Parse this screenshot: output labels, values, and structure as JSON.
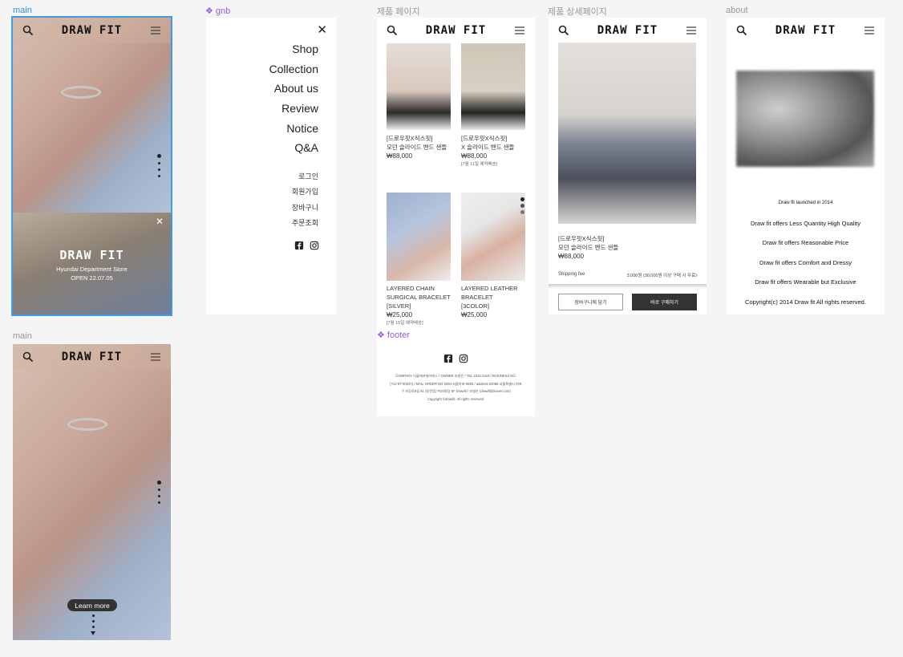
{
  "labels": {
    "main_top": "main",
    "gnb": "❖ gnb",
    "product_page": "제품 페이지",
    "detail_page": "제품 상세페이지",
    "about": "about",
    "main_bottom": "main",
    "footer": "❖ footer"
  },
  "brand": {
    "logo": "DRAW FIT"
  },
  "main_top": {
    "popup_title": "DRAW FIT",
    "popup_line1": "Hyundai Department Store",
    "popup_line2": "OPEN 22.07.05",
    "close_glyph": "✕"
  },
  "gnb": {
    "close_glyph": "✕",
    "menu": [
      "Shop",
      "Collection",
      "About us",
      "Review",
      "Notice",
      "Q&A"
    ],
    "sub": [
      "로그인",
      "회원가입",
      "장바구니",
      "주문조회"
    ]
  },
  "products": [
    {
      "line1": "[드로우핏X식스핏]",
      "line2": "모던 슬라이드 밴드 샌들",
      "price": "₩88,000",
      "note": ""
    },
    {
      "line1": "[드로우핏X식스핏]",
      "line2": "X 슬라이드 밴드 샌들",
      "price": "₩88,000",
      "note": "[7월 11일 예약배송]"
    },
    {
      "line1": "LAYERED CHAIN",
      "line2": "SURGICAL BRACELET",
      "line3": "[SILVER]",
      "price": "₩25,000",
      "note": "[7월 15일 예약배송]"
    },
    {
      "line1": "LAYERED LEATHER",
      "line2": "BRACELET",
      "line3": "[3COLOR]",
      "price": "₩25,000",
      "note": ""
    }
  ],
  "footer": {
    "line1": "COMPANY 더블에프제이에스 / OWNER 조영은 / TEL 1533-3319 / BUSINESS NO.",
    "line2": "(712-87-00037) / MAIL-ORDER NO 2020-서울마포-0808 / address 04088 서울특별시 마포",
    "line3": "구 서강로9길 61 (창전동) FDS빌딩 5F Drawfit / 조영은 (drawfit@naver.com)",
    "copyright": "Copyright ©drawfit. All rights reserved."
  },
  "detail": {
    "line1": "[드로우핏X식스핏]",
    "line2": "모던 슬라이드 밴드 샌들",
    "price": "₩88,000",
    "shipping_label": "Shipping fee",
    "shipping_value": "3,000원 (30,000원 이상 구매 시 무료)",
    "cart_button": "장바구니에 담기",
    "buy_button": "바로 구매하기"
  },
  "about": {
    "lines": [
      "Draw fit launched in 2014",
      "Draw fit offers Less Quantity High Quality",
      "Draw fit offers Reasonable Price",
      "Draw fit offers Comfort and Dressy",
      "Draw fit offers Wearable but Exclusive",
      "Copyright(c) 2014 Draw fit All rights reserved."
    ]
  },
  "main_bottom": {
    "learn_more": "Learn more"
  },
  "icons": {
    "search": "search-icon",
    "menu": "hamburger-menu-icon",
    "close": "close-icon",
    "facebook": "facebook-icon",
    "instagram": "instagram-icon"
  }
}
